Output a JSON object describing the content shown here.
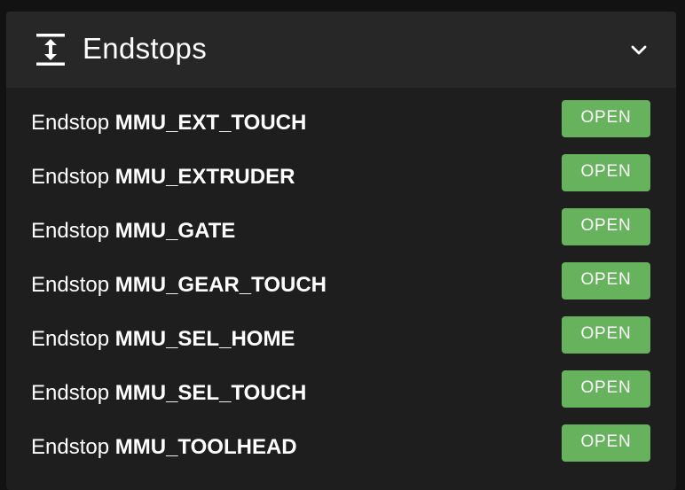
{
  "panel": {
    "title": "Endstops",
    "icon": "arrow-expand-vertical-icon",
    "collapse_icon": "chevron-down-icon"
  },
  "endstops": [
    {
      "prefix": "Endstop",
      "name": "MMU_EXT_TOUCH",
      "status": "OPEN"
    },
    {
      "prefix": "Endstop",
      "name": "MMU_EXTRUDER",
      "status": "OPEN"
    },
    {
      "prefix": "Endstop",
      "name": "MMU_GATE",
      "status": "OPEN"
    },
    {
      "prefix": "Endstop",
      "name": "MMU_GEAR_TOUCH",
      "status": "OPEN"
    },
    {
      "prefix": "Endstop",
      "name": "MMU_SEL_HOME",
      "status": "OPEN"
    },
    {
      "prefix": "Endstop",
      "name": "MMU_SEL_TOUCH",
      "status": "OPEN"
    },
    {
      "prefix": "Endstop",
      "name": "MMU_TOOLHEAD",
      "status": "OPEN"
    }
  ],
  "colors": {
    "open_status": "#67b35d",
    "panel_bg": "#1e1e1e",
    "header_bg": "#272727"
  }
}
